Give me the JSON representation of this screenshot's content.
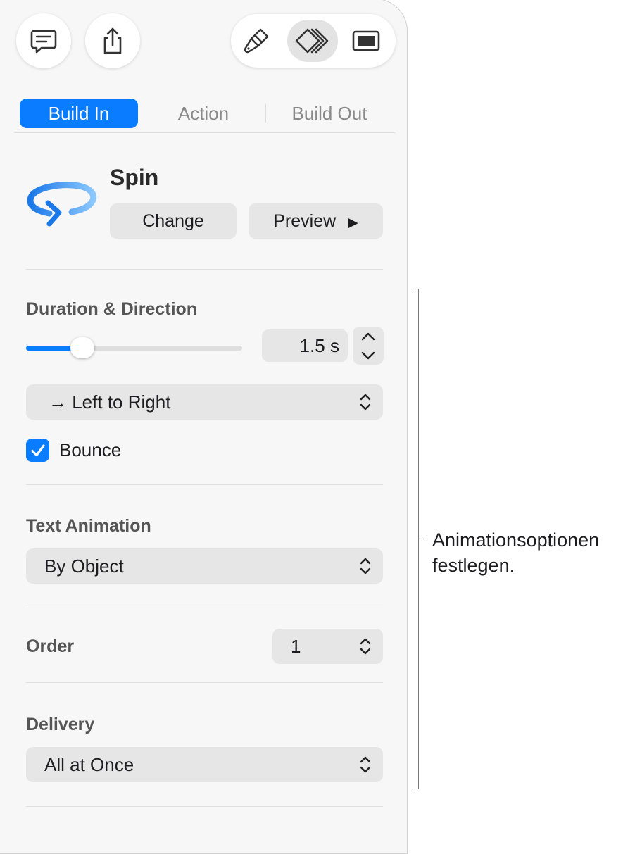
{
  "toolbar": {
    "comment_icon": "comment-icon",
    "share_icon": "share-icon",
    "format_icon": "paintbrush-icon",
    "animate_icon": "animate-icon",
    "document_icon": "document-icon"
  },
  "tabs": [
    {
      "label": "Build In",
      "active": true
    },
    {
      "label": "Action",
      "active": false
    },
    {
      "label": "Build Out",
      "active": false
    }
  ],
  "effect": {
    "name": "Spin",
    "change_label": "Change",
    "preview_label": "Preview",
    "preview_glyph": "▶"
  },
  "duration": {
    "section_label": "Duration & Direction",
    "value": "1.5 s",
    "slider_fraction": 0.26
  },
  "direction": {
    "selected": "→ Left to Right"
  },
  "bounce": {
    "label": "Bounce",
    "checked": true
  },
  "text_animation": {
    "section_label": "Text Animation",
    "selected": "By Object"
  },
  "order": {
    "label": "Order",
    "selected": "1"
  },
  "delivery": {
    "section_label": "Delivery",
    "selected": "All at Once"
  },
  "annotation": {
    "line1": "Animationsoptionen",
    "line2": "festlegen."
  },
  "colors": {
    "accent": "#0a7cff",
    "panel": "#f7f7f7",
    "control": "#e6e6e6"
  }
}
